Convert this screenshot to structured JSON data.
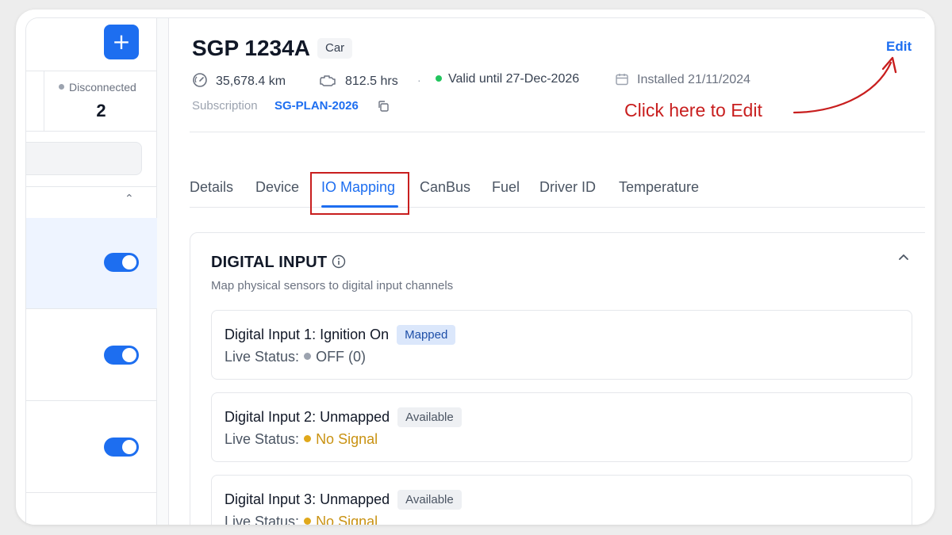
{
  "sidebar": {
    "add_button": "+",
    "disconnected_label": "Disconnected",
    "disconnected_count": "2",
    "toggles_on": [
      true,
      true,
      true
    ]
  },
  "vehicle": {
    "plate": "SGP 1234A",
    "type": "Car",
    "edit_label": "Edit",
    "odometer": "35,678.4 km",
    "engine_hours": "812.5 hrs",
    "validity": "Valid until 27-Dec-2026",
    "installed": "Installed 21/11/2024",
    "subscription_label": "Subscription",
    "subscription_value": "SG-PLAN-2026"
  },
  "annotation": {
    "text": "Click here to Edit",
    "color": "#c81e1e"
  },
  "tabs": [
    {
      "label": "Details"
    },
    {
      "label": "Device"
    },
    {
      "label": "IO Mapping"
    },
    {
      "label": "CanBus"
    },
    {
      "label": "Fuel"
    },
    {
      "label": "Driver ID"
    },
    {
      "label": "Temperature"
    }
  ],
  "active_tab": "IO Mapping",
  "digital_input": {
    "title": "DIGITAL INPUT",
    "subtitle": "Map physical sensors to digital input channels",
    "items": [
      {
        "name": "Digital Input 1: Ignition On",
        "badge": "Mapped",
        "live_label": "Live Status:",
        "status": "OFF (0)",
        "status_color": "#9ca3af"
      },
      {
        "name": "Digital Input 2: Unmapped",
        "badge": "Available",
        "live_label": "Live Status:",
        "status": "No Signal",
        "status_color": "#e0a81b"
      },
      {
        "name": "Digital Input 3: Unmapped",
        "badge": "Available",
        "live_label": "Live Status:",
        "status": "No Signal",
        "status_color": "#e0a81b"
      }
    ]
  },
  "colors": {
    "accent": "#1d6ef0",
    "valid_green": "#22c55e"
  }
}
